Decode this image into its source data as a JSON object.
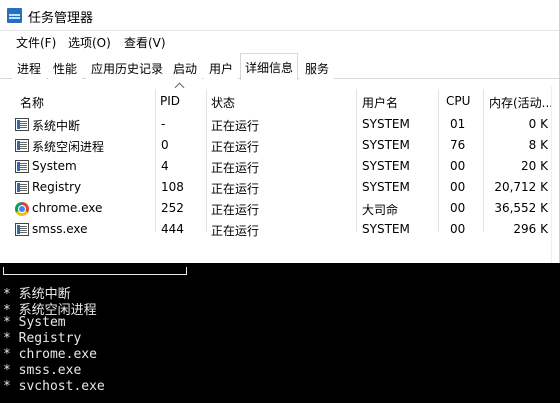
{
  "window": {
    "title": "任务管理器"
  },
  "menu": [
    "文件(F)",
    "选项(O)",
    "查看(V)"
  ],
  "tabs": [
    "进程",
    "性能",
    "应用历史记录",
    "启动",
    "用户",
    "详细信息",
    "服务"
  ],
  "active_tab": "详细信息",
  "table": {
    "headers": {
      "name": "名称",
      "pid": "PID",
      "status": "状态",
      "user": "用户名",
      "cpu": "CPU",
      "mem": "内存(活动..."
    },
    "rows": [
      {
        "name": "系统中断",
        "pid": "-",
        "status": "正在运行",
        "user": "SYSTEM",
        "cpu": "01",
        "mem": "0 K",
        "icon": "system-process-icon"
      },
      {
        "name": "系统空闲进程",
        "pid": "0",
        "status": "正在运行",
        "user": "SYSTEM",
        "cpu": "76",
        "mem": "8 K",
        "icon": "system-process-icon"
      },
      {
        "name": "System",
        "pid": "4",
        "status": "正在运行",
        "user": "SYSTEM",
        "cpu": "00",
        "mem": "20 K",
        "icon": "system-process-icon"
      },
      {
        "name": "Registry",
        "pid": "108",
        "status": "正在运行",
        "user": "SYSTEM",
        "cpu": "00",
        "mem": "20,712 K",
        "icon": "system-process-icon"
      },
      {
        "name": "chrome.exe",
        "pid": "252",
        "status": "正在运行",
        "user": "大司命",
        "cpu": "00",
        "mem": "36,552 K",
        "icon": "chrome-icon"
      },
      {
        "name": "smss.exe",
        "pid": "444",
        "status": "正在运行",
        "user": "SYSTEM",
        "cpu": "00",
        "mem": "296 K",
        "icon": "system-process-icon"
      }
    ]
  },
  "console": {
    "lines": [
      "* 系统中断",
      "* 系统空闲进程",
      "* System",
      "* Registry",
      "* chrome.exe",
      "* smss.exe",
      "* svchost.exe"
    ]
  }
}
